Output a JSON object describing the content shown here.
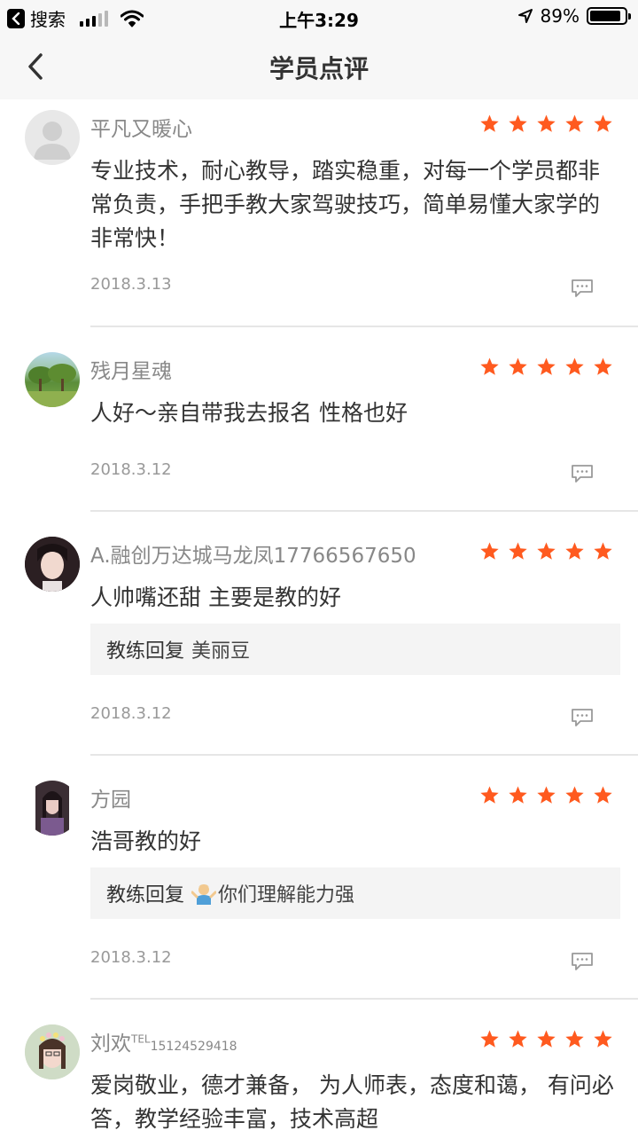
{
  "status_bar": {
    "back_app_label": "搜索",
    "time": "上午3:29",
    "battery": "89%",
    "battery_level": 0.89
  },
  "nav": {
    "title": "学员点评"
  },
  "colors": {
    "star": "#ff5a1f",
    "divider": "#e6e6e6",
    "reply_bg": "#f4f4f4"
  },
  "reviews": [
    {
      "name": "平凡又暖心",
      "avatar_icon": "default-user-icon",
      "rating": 5,
      "content": "专业技术，耐心教导，踏实稳重，对每一个学员都非常负责，手把手教大家驾驶技巧，简单易懂大家学的非常快！",
      "date": "2018.3.13"
    },
    {
      "name": "残月星魂",
      "avatar_icon": "tree-photo-avatar",
      "rating": 5,
      "content": "人好～亲自带我去报名 性格也好",
      "date": "2018.3.12"
    },
    {
      "name": "A.融创万达城马龙凤17766567650",
      "avatar_icon": "girl-photo-avatar",
      "rating": 5,
      "content": "人帅嘴还甜 主要是教的好",
      "reply_label": "教练回复",
      "reply_text": "美丽豆",
      "date": "2018.3.12"
    },
    {
      "name": "方园",
      "avatar_icon": "girl-photo-avatar",
      "rating": 5,
      "content": "浩哥教的好",
      "reply_label": "教练回复",
      "reply_emoji": "shrug-emoji",
      "reply_text": "你们理解能力强",
      "date": "2018.3.12"
    },
    {
      "name": "刘欢",
      "name_sup": "TEL",
      "name_small": "15124529418",
      "avatar_icon": "girl-photo-avatar",
      "rating": 5,
      "content": "爱岗敬业，德才兼备， 为人师表，态度和蔼， 有问必答，教学经验丰富，技术高超"
    }
  ]
}
